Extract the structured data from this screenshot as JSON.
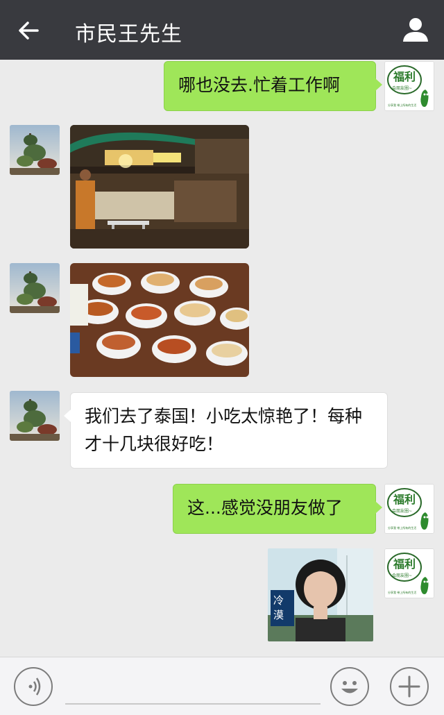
{
  "header": {
    "title": "市民王先生",
    "back_icon": "arrow-left-icon",
    "profile_icon": "user-icon"
  },
  "messages": [
    {
      "sender": "me",
      "type": "text",
      "text": "哪也没去.忙着工作啊"
    },
    {
      "sender": "friend",
      "type": "image",
      "image": "night-market-food-stall"
    },
    {
      "sender": "friend",
      "type": "image",
      "image": "fried-snacks-in-bowls"
    },
    {
      "sender": "friend",
      "type": "text",
      "text": "我们去了泰国！小吃太惊艳了！每种才十几块很好吃！"
    },
    {
      "sender": "me",
      "type": "text",
      "text": "这...感觉没朋友做了"
    },
    {
      "sender": "me",
      "type": "image",
      "image": "woman-portrait-meme",
      "caption": "冷漠"
    }
  ],
  "my_avatar": {
    "main_text": "福利",
    "sub_text": "会朋友圈~",
    "tiny_text": "分享我 带上所有的生活"
  },
  "input_bar": {
    "voice_icon": "voice-icon",
    "emoji_icon": "smiley-icon",
    "plus_icon": "plus-icon"
  },
  "colors": {
    "header_bg": "#393a3f",
    "chat_bg": "#ebebeb",
    "my_bubble": "#9fe659",
    "friend_bubble": "#ffffff"
  }
}
